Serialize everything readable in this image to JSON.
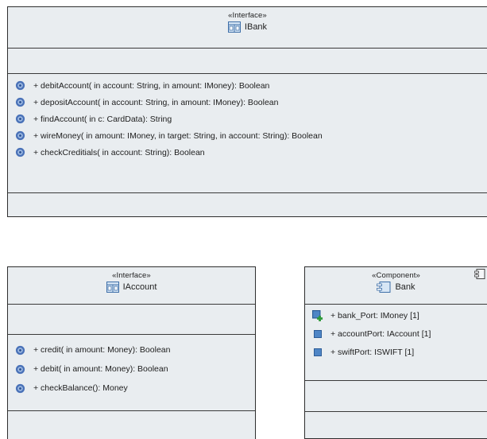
{
  "colors": {
    "box_fill": "#e9edf0",
    "border": "#2e2e2e",
    "gear_icon": "#4a72b8",
    "port_icon": "#4f86c6",
    "port_plus": "#2f9a3b"
  },
  "ibank": {
    "stereotype": "«Interface»",
    "name": "IBank",
    "icon": "interface-icon",
    "operations": [
      "+ debitAccount( in account: String,   in amount: IMoney): Boolean",
      "+ depositAccount( in account: String,   in amount: IMoney): Boolean",
      "+ findAccount( in c: CardData): String",
      "+ wireMoney( in amount: IMoney,   in target: String,   in account: String): Boolean",
      "+ checkCreditials( in account: String): Boolean"
    ]
  },
  "iaccount": {
    "stereotype": "«Interface»",
    "name": "IAccount",
    "icon": "interface-icon",
    "operations": [
      "+ credit( in amount: Money): Boolean",
      "+ debit( in amount: Money): Boolean",
      "+ checkBalance(): Money"
    ]
  },
  "bank": {
    "stereotype": "«Component»",
    "name": "Bank",
    "icon": "component-icon",
    "ports": [
      "+ bank_Port: IMoney [1]",
      "+ accountPort: IAccount [1]",
      "+ swiftPort: ISWIFT [1]"
    ]
  }
}
